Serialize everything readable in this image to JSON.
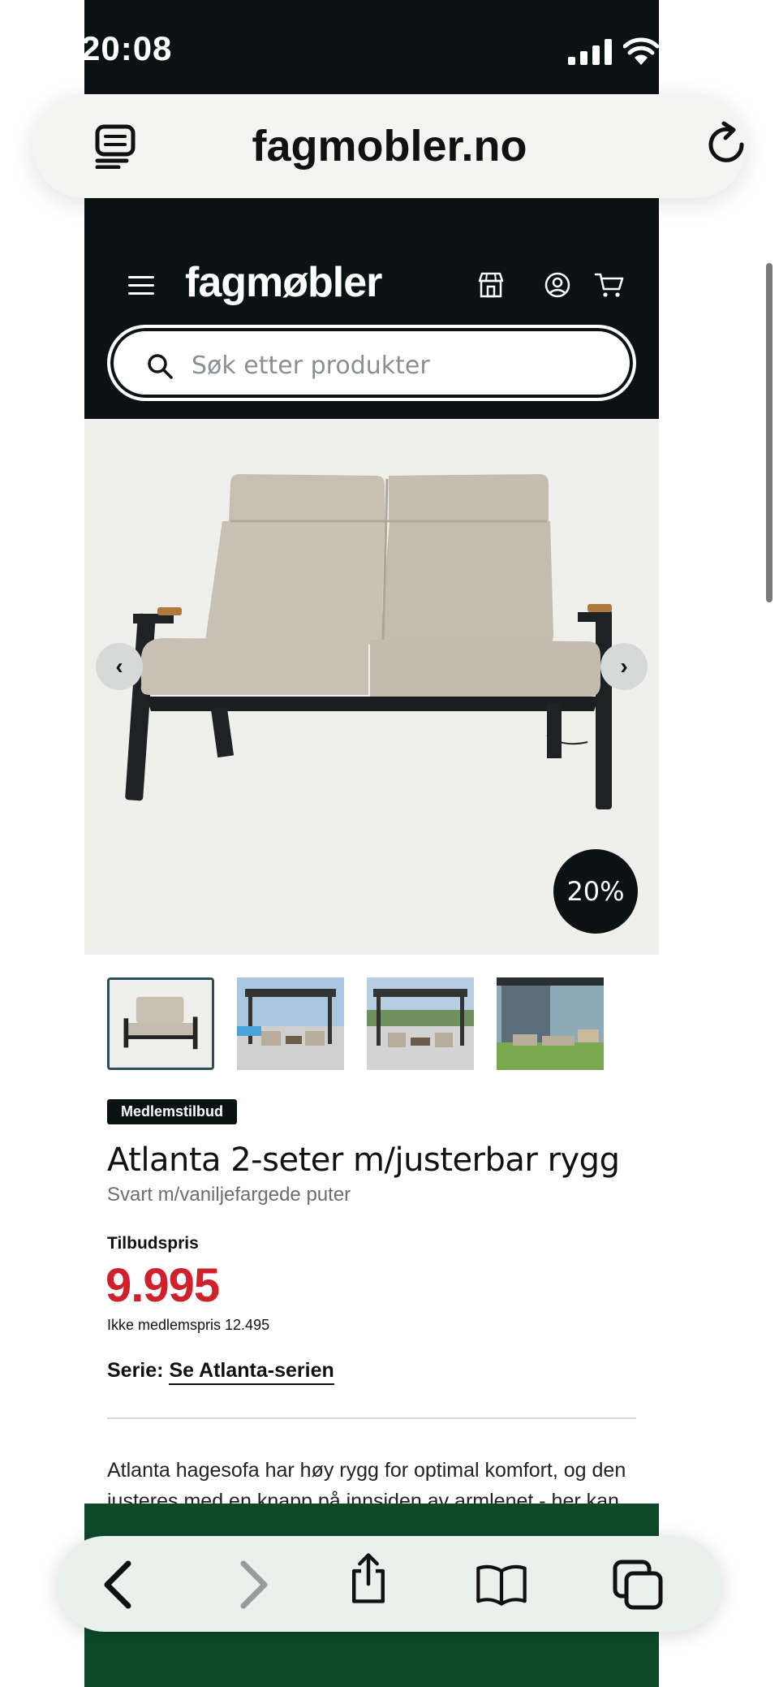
{
  "status_bar": {
    "time": "20:08"
  },
  "browser": {
    "url": "fagmobler.no",
    "reader_icon": "reader-icon",
    "reload_icon": "reload-icon"
  },
  "header": {
    "logo": "fagmøbler",
    "menu_icon": "hamburger-menu-icon",
    "store_icon": "store-icon",
    "account_icon": "user-icon",
    "cart_icon": "cart-icon",
    "search": {
      "placeholder": "Søk etter produkter",
      "icon": "search-icon"
    }
  },
  "gallery": {
    "discount_badge": "20%",
    "prev_label": "‹",
    "next_label": "›",
    "thumbnail_count": 4
  },
  "product": {
    "tag": "Medlemstilbud",
    "title": "Atlanta 2-seter m/justerbar rygg",
    "subtitle": "Svart m/vaniljefargede puter",
    "offer_label": "Tilbudspris",
    "price": "9.995",
    "non_member_price": "Ikke medlemspris 12.495",
    "series_label": "Serie:",
    "series_link": "Se Atlanta-serien",
    "description": "Atlanta hagesofa har høy rygg for optimal komfort, og den justeres med en knapp på innsiden av armlenet - her kan du"
  },
  "colors": {
    "header_bg": "#0b1214",
    "price_red": "#d0202b",
    "footer_green": "#0e4a2a"
  },
  "toolbar": {
    "back_icon": "back-chevron-icon",
    "forward_icon": "forward-chevron-icon",
    "share_icon": "share-icon",
    "bookmarks_icon": "book-icon",
    "tabs_icon": "tabs-icon"
  }
}
